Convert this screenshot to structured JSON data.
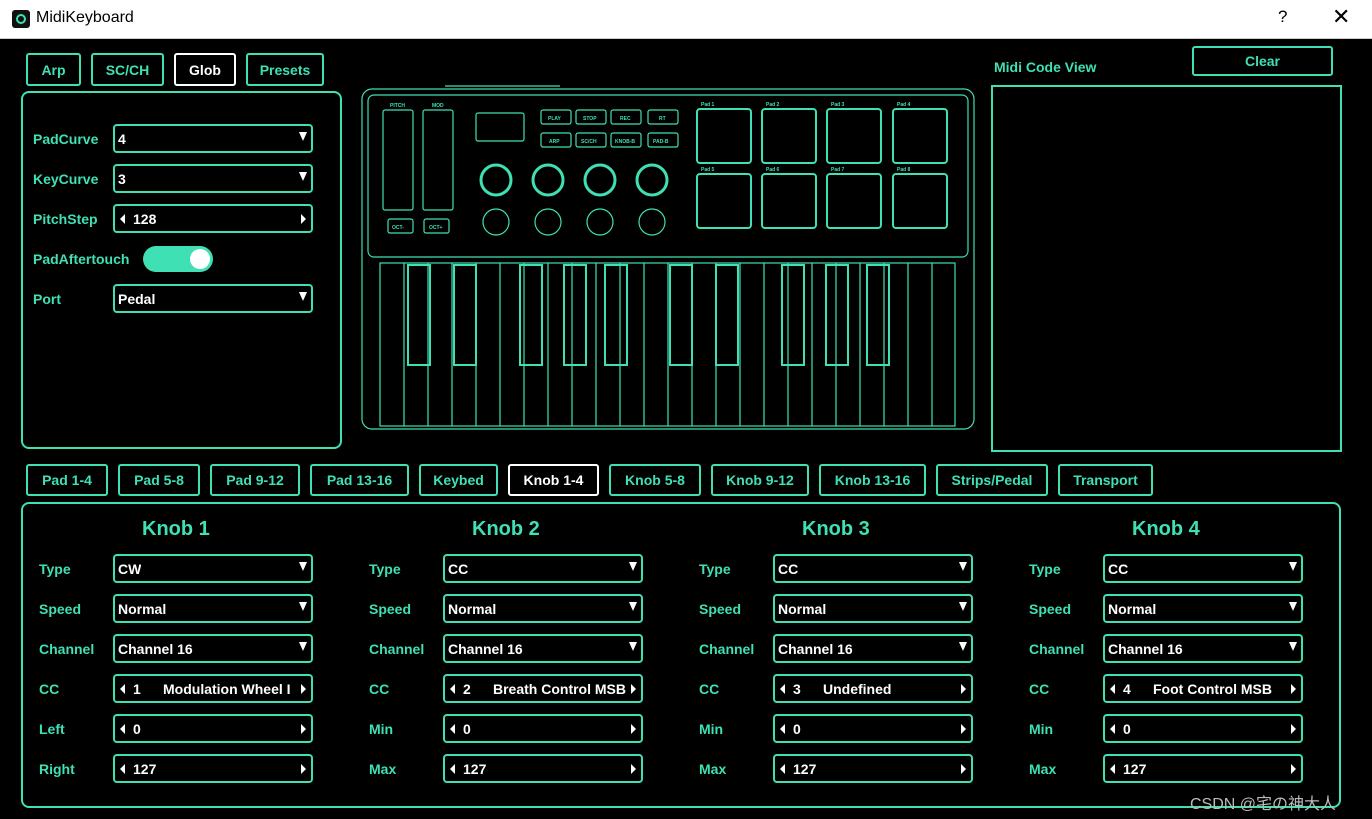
{
  "window": {
    "title": "MidiKeyboard",
    "help": "?",
    "close": "✕"
  },
  "top_tabs": [
    {
      "label": "Arp",
      "active": false
    },
    {
      "label": "SC/CH",
      "active": false
    },
    {
      "label": "Glob",
      "active": true
    },
    {
      "label": "Presets",
      "active": false
    }
  ],
  "glob": {
    "rows": [
      {
        "label": "PadCurve",
        "value": "4"
      },
      {
        "label": "KeyCurve",
        "value": "3"
      },
      {
        "label": "PitchStep",
        "value": "128"
      },
      {
        "label": "PadAftertouch",
        "value": "on"
      },
      {
        "label": "Port",
        "value": "Pedal"
      }
    ]
  },
  "code_view": {
    "title": "Midi Code View",
    "clear": "Clear"
  },
  "keyboard": {
    "labels": {
      "pitch": "PITCH",
      "mod": "MOD",
      "buttons": [
        "PLAY",
        "STOP",
        "REC",
        "RT",
        "ARP",
        "SC/CH",
        "KNOB-B",
        "PAD-B"
      ],
      "oct": [
        "OCT-",
        "OCT+"
      ],
      "pads": [
        "Pad 1",
        "Pad 2",
        "Pad 3",
        "Pad 4",
        "Pad 5",
        "Pad 6",
        "Pad 7",
        "Pad 8"
      ]
    }
  },
  "bottom_tabs": [
    {
      "label": "Pad 1-4",
      "active": false
    },
    {
      "label": "Pad 5-8",
      "active": false
    },
    {
      "label": "Pad 9-12",
      "active": false
    },
    {
      "label": "Pad 13-16",
      "active": false
    },
    {
      "label": "Keybed",
      "active": false
    },
    {
      "label": "Knob 1-4",
      "active": true
    },
    {
      "label": "Knob 5-8",
      "active": false
    },
    {
      "label": "Knob 9-12",
      "active": false
    },
    {
      "label": "Knob 13-16",
      "active": false
    },
    {
      "label": "Strips/Pedal",
      "active": false
    },
    {
      "label": "Transport",
      "active": false
    }
  ],
  "knobs": [
    {
      "title": "Knob 1",
      "type": "CW",
      "speed": "Normal",
      "channel": "Channel 16",
      "cc_num": "1",
      "cc_name": "Modulation Wheel I",
      "min_label": "Left",
      "min": "0",
      "max_label": "Right",
      "max": "127"
    },
    {
      "title": "Knob 2",
      "type": "CC",
      "speed": "Normal",
      "channel": "Channel 16",
      "cc_num": "2",
      "cc_name": "Breath Control MSB",
      "min_label": "Min",
      "min": "0",
      "max_label": "Max",
      "max": "127"
    },
    {
      "title": "Knob 3",
      "type": "CC",
      "speed": "Normal",
      "channel": "Channel 16",
      "cc_num": "3",
      "cc_name": "Undefined",
      "min_label": "Min",
      "min": "0",
      "max_label": "Max",
      "max": "127"
    },
    {
      "title": "Knob 4",
      "type": "CC",
      "speed": "Normal",
      "channel": "Channel 16",
      "cc_num": "4",
      "cc_name": "Foot Control MSB",
      "min_label": "Min",
      "min": "0",
      "max_label": "Max",
      "max": "127"
    }
  ],
  "knob_field_labels": {
    "type": "Type",
    "speed": "Speed",
    "channel": "Channel",
    "cc": "CC"
  },
  "watermark": "CSDN @宅の神大人",
  "colors": {
    "accent": "#3fe0b4",
    "background": "#000000",
    "active_tab": "#ffffff"
  }
}
